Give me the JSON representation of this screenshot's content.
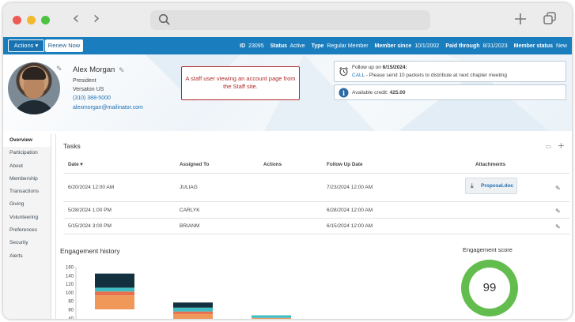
{
  "browser": {
    "back": "‹",
    "forward": "›"
  },
  "appbar": {
    "actions_label": "Actions ▾",
    "renew_label": "Renew Now",
    "meta": [
      {
        "label": "ID",
        "value": "23095"
      },
      {
        "label": "Status",
        "value": "Active"
      },
      {
        "label": "Type",
        "value": "Regular Member"
      },
      {
        "label": "Member since",
        "value": "10/1/2002"
      },
      {
        "label": "Paid through",
        "value": "8/31/2023"
      },
      {
        "label": "Member status",
        "value": "New"
      }
    ]
  },
  "profile": {
    "name": "Alex Morgan",
    "title": "President",
    "company": "Versaton US",
    "phone": "(310) 388-5000",
    "email": "alexmorgan@mailinator.com"
  },
  "callout": {
    "text": "A staff user viewing an account page from the Staff site."
  },
  "followup": {
    "prefix": "Follow up on",
    "date": "6/15/2024:",
    "type": "CALL",
    "note": " - Please send 10 packets to distribute at next chapter meeting"
  },
  "credit": {
    "label": "Available credit:",
    "value": "425.00"
  },
  "leftnav": [
    "Overview",
    "Participation",
    "About",
    "Membership",
    "Transactions",
    "Giving",
    "Volunteering",
    "Preferences",
    "Security",
    "Alerts"
  ],
  "tasks": {
    "title": "Tasks",
    "columns": {
      "date": "Date ▾",
      "assigned": "Assigned To",
      "actions": "Actions",
      "followup": "Follow Up Date",
      "attachments": "Attachments"
    },
    "rows": [
      {
        "date": "6/20/2024 12:00 AM",
        "assigned": "JULIAG",
        "followup": "7/23/2024 12:00 AM",
        "attachment": "Proposal.doc"
      },
      {
        "date": "5/28/2024 1:00 PM",
        "assigned": "CARLYK",
        "followup": "6/28/2024 12:00 AM",
        "attachment": ""
      },
      {
        "date": "5/15/2024 3:00 PM",
        "assigned": "BRIANM",
        "followup": "6/15/2024 12:00 AM",
        "attachment": ""
      }
    ]
  },
  "engagement": {
    "history_title": "Engagement history",
    "score_title": "Engagement score",
    "score": "99"
  },
  "chart_data": {
    "type": "bar",
    "yticks": [
      "160",
      "140",
      "120",
      "100",
      "80",
      "60",
      "40"
    ],
    "ylim": [
      40,
      160
    ],
    "colors": [
      "#f0975a",
      "#e8704f",
      "#3fbfc4",
      "#12303d"
    ],
    "bars": [
      {
        "segments": [
          55,
          15,
          15,
          55
        ]
      },
      {
        "segments": [
          25,
          10,
          15,
          20
        ]
      },
      {
        "segments": [
          10,
          0,
          10,
          0
        ]
      }
    ]
  }
}
